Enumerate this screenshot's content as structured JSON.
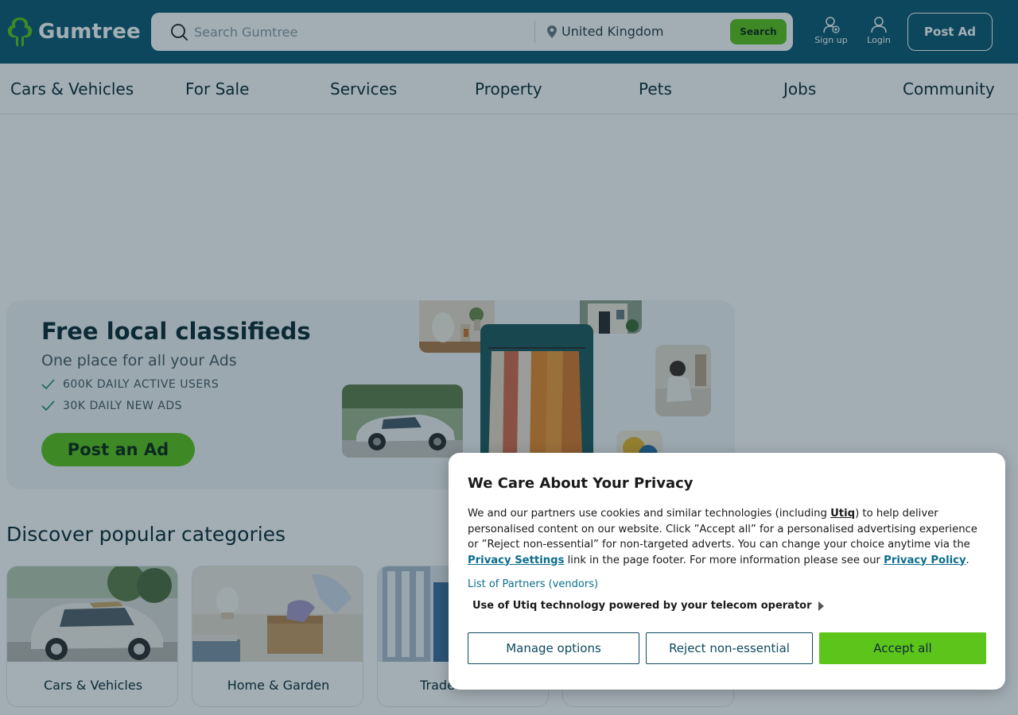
{
  "header": {
    "logo_text": "Gumtree",
    "search_placeholder": "Search Gumtree",
    "location": "United Kingdom",
    "search_button": "Search",
    "signup_label": "Sign up",
    "login_label": "Login",
    "post_ad_label": "Post Ad"
  },
  "nav": {
    "items": [
      "Cars & Vehicles",
      "For Sale",
      "Services",
      "Property",
      "Pets",
      "Jobs",
      "Community"
    ]
  },
  "hero": {
    "title": "Free local classifieds",
    "subtitle": "One place for all your Ads",
    "features": [
      "600K DAILY ACTIVE USERS",
      "30K DAILY NEW ADS"
    ],
    "cta": "Post an Ad"
  },
  "categories": {
    "title": "Discover popular categories",
    "items": [
      "Cars & Vehicles",
      "Home & Garden",
      "Trade",
      ""
    ]
  },
  "privacy": {
    "title": "We Care About Your Privacy",
    "body_1": "We and our partners use cookies and similar technologies (including ",
    "utiq": "Utiq",
    "body_2": ") to help deliver personalised content on our website. Click ”Accept all” for a personalised advertising experience or ”Reject non-essential” for non-targeted adverts. You can change your choice anytime via the ",
    "privacy_settings": "Privacy Settings",
    "body_3": " link in the page footer. For more information please see our ",
    "privacy_policy": "Privacy Policy",
    "body_4": ".",
    "partners_link": "List of Partners (vendors)",
    "utiq_row": "Use of Utiq technology powered by your telecom operator",
    "manage_options": "Manage options",
    "reject": "Reject non-essential",
    "accept": "Accept all"
  },
  "colors": {
    "header_bg": "#0e5a73",
    "brand_green": "#5cc41b",
    "link_blue": "#0b6d8c",
    "overlay": "rgba(12,42,58,0.38)"
  },
  "icons": {
    "logo": "tree-icon",
    "search": "search-icon",
    "location": "pin-icon",
    "signup": "user-plus-icon",
    "login": "user-icon",
    "check": "check-icon",
    "expand": "caret-right-icon"
  }
}
